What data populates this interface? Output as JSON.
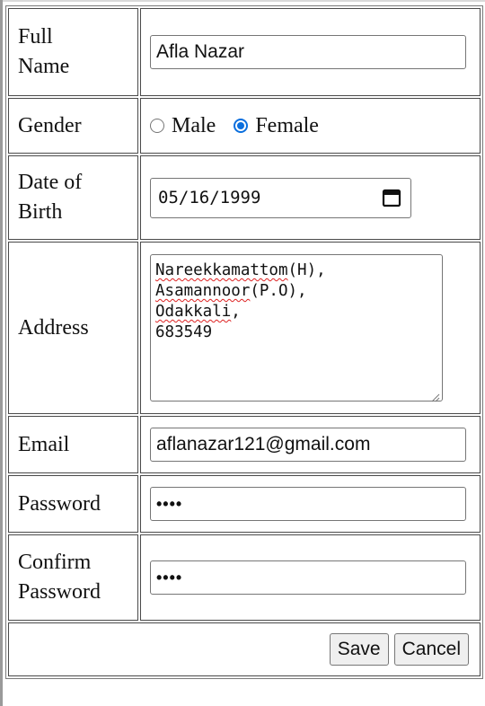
{
  "form": {
    "full_name": {
      "label_line1": "Full",
      "label_line2": "Name",
      "value": "Afla Nazar"
    },
    "gender": {
      "label": "Gender",
      "options": [
        "Male",
        "Female"
      ],
      "selected": "Female"
    },
    "dob": {
      "label_line1": "Date of",
      "label_line2": "Birth",
      "value": "05/16/1999",
      "icon": "calendar-icon"
    },
    "address": {
      "label": "Address",
      "lines": [
        "Nareekkamattom(H),",
        "Asamannoor(P.O),",
        "Odakkali,",
        "683549"
      ]
    },
    "email": {
      "label": "Email",
      "value": "aflanazar121@gmail.com"
    },
    "password": {
      "label": "Password",
      "masked": "••••"
    },
    "confirm_password": {
      "label_line1": "Confirm",
      "label_line2": "Password",
      "masked": "••••"
    },
    "buttons": {
      "save": "Save",
      "cancel": "Cancel"
    }
  },
  "colors": {
    "radio_accent": "#0b6fde",
    "spell_error": "#d22222"
  }
}
